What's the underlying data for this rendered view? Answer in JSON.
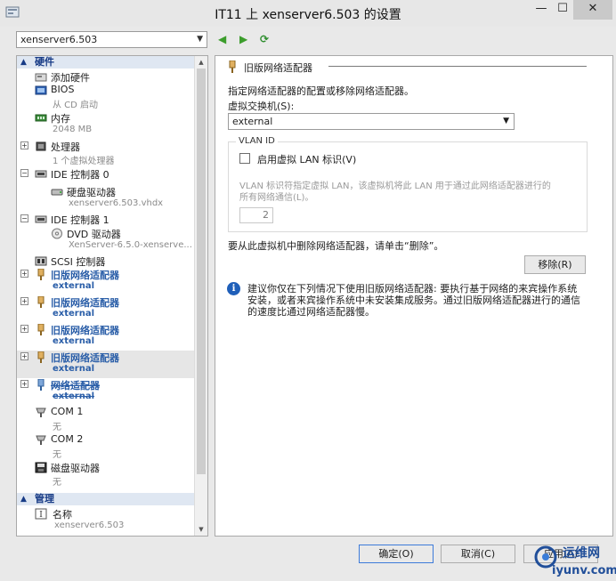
{
  "window": {
    "title": "IT11 上 xenserver6.503 的设置",
    "minimize_glyph": "—",
    "maximize_glyph": "☐",
    "close_glyph": "✕"
  },
  "toolbar": {
    "vm_name": "xenserver6.503",
    "back_icon": "arrow-left-icon",
    "forward_icon": "arrow-right-icon",
    "refresh_icon": "refresh-icon"
  },
  "sidebar": {
    "hardware_header": "硬件",
    "management_header": "管理",
    "items": [
      {
        "label": "添加硬件",
        "sub": "",
        "icon": "add-hardware-icon",
        "expand": ""
      },
      {
        "label": "BIOS",
        "sub": "从 CD 启动",
        "icon": "bios-icon",
        "expand": ""
      },
      {
        "label": "内存",
        "sub": "2048 MB",
        "icon": "memory-icon",
        "expand": ""
      },
      {
        "label": "处理器",
        "sub": "1 个虚拟处理器",
        "icon": "processor-icon",
        "expand": "+"
      },
      {
        "label": "IDE 控制器 0",
        "sub": "",
        "icon": "ide-controller-icon",
        "expand": "−"
      },
      {
        "label": "硬盘驱动器",
        "sub": "xenserver6.503.vhdx",
        "icon": "hard-drive-icon",
        "expand": ""
      },
      {
        "label": "IDE 控制器 1",
        "sub": "",
        "icon": "ide-controller-icon",
        "expand": "−"
      },
      {
        "label": "DVD 驱动器",
        "sub": "XenServer-6.5.0-xenserve...",
        "icon": "dvd-drive-icon",
        "expand": ""
      },
      {
        "label": "SCSI 控制器",
        "sub": "",
        "icon": "scsi-controller-icon",
        "expand": ""
      },
      {
        "label": "旧版网络适配器",
        "sub": "external",
        "icon": "legacy-network-adapter-icon",
        "expand": "+"
      },
      {
        "label": "旧版网络适配器",
        "sub": "external",
        "icon": "legacy-network-adapter-icon",
        "expand": "+"
      },
      {
        "label": "旧版网络适配器",
        "sub": "external",
        "icon": "legacy-network-adapter-icon",
        "expand": "+"
      },
      {
        "label": "旧版网络适配器",
        "sub": "external",
        "icon": "legacy-network-adapter-icon",
        "expand": "+"
      },
      {
        "label": "网络适配器",
        "sub": "external",
        "icon": "network-adapter-icon",
        "expand": "+"
      },
      {
        "label": "COM 1",
        "sub": "无",
        "icon": "com-port-icon",
        "expand": ""
      },
      {
        "label": "COM 2",
        "sub": "无",
        "icon": "com-port-icon",
        "expand": ""
      },
      {
        "label": "磁盘驱动器",
        "sub": "无",
        "icon": "floppy-drive-icon",
        "expand": ""
      }
    ],
    "management_items": [
      {
        "label": "名称",
        "sub": "xenserver6.503",
        "icon": "name-icon"
      }
    ]
  },
  "detail": {
    "title": "旧版网络适配器",
    "description": "指定网络适配器的配置或移除网络适配器。",
    "switch_label": "虚拟交换机(S):",
    "switch_value": "external",
    "vlan_group": "VLAN ID",
    "vlan_checkbox": "启用虚拟 LAN 标识(V)",
    "vlan_help_line1": "VLAN 标识符指定虚拟 LAN，该虚拟机将此 LAN 用于通过此网络适配器进行的",
    "vlan_help_line2": "所有网络通信(L)。",
    "vlan_value": "2",
    "remove_prompt": "要从此虚拟机中删除网络适配器，请单击“删除”。",
    "remove_button": "移除(R)",
    "info_icon_glyph": "i",
    "info_text": "建议你仅在下列情况下使用旧版网络适配器: 要执行基于网络的来宾操作系统安装，或者来宾操作系统中未安装集成服务。通过旧版网络适配器进行的通信的速度比通过网络适配器慢。"
  },
  "footer": {
    "ok": "确定(O)",
    "cancel": "取消(C)",
    "apply": "应用(A)"
  },
  "watermark": {
    "line1": "运维网",
    "line2": "iyunv.com"
  },
  "colors": {
    "accent": "#2a5ea8",
    "section_header_bg": "#dfe7f2",
    "selected_row": "#e6e6e6",
    "nav_green": "#3c9d2c"
  }
}
